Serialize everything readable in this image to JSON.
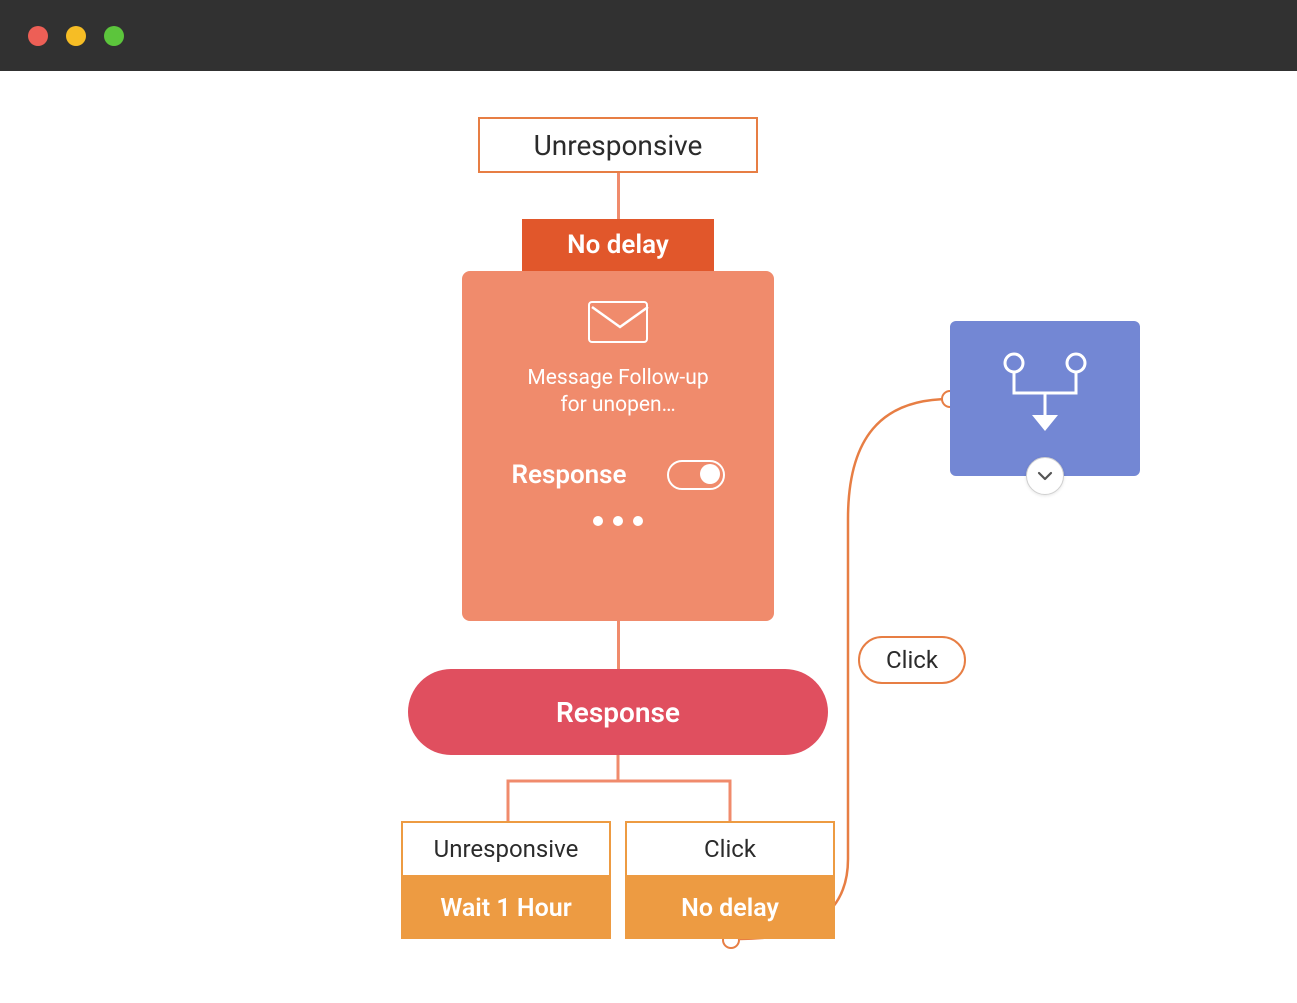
{
  "titlebar": {
    "colors": {
      "red": "#ED5F56",
      "yellow": "#F6BD25",
      "green": "#5CC53C"
    }
  },
  "flow": {
    "root": {
      "label": "Unresponsive"
    },
    "root_delay": "No delay",
    "message_card": {
      "line1": "Message Follow-up",
      "line2": "for unopen…",
      "response_label": "Response",
      "toggle_on": true
    },
    "decision_label": "Response",
    "branches": {
      "left": {
        "label": "Unresponsive",
        "delay": "Wait 1 Hour"
      },
      "right": {
        "label": "Click",
        "delay": "No delay"
      }
    },
    "click_pill": "Click"
  }
}
